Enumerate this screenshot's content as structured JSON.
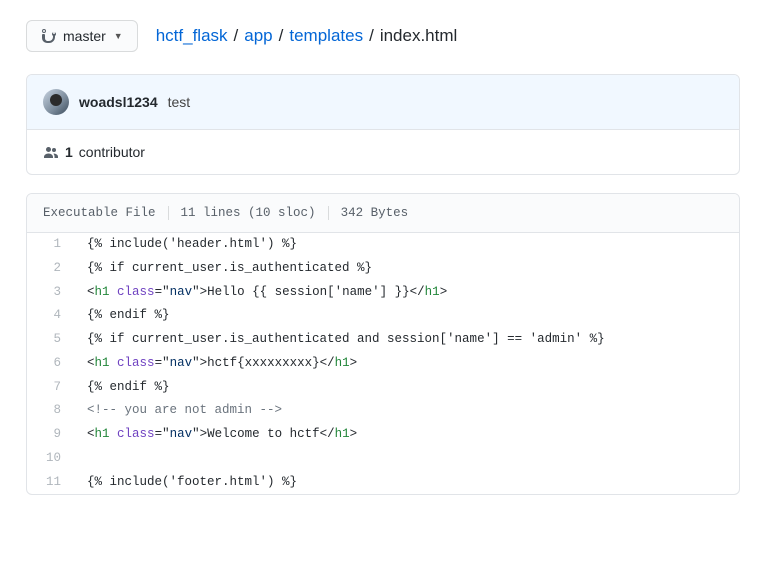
{
  "branch": {
    "label": "master"
  },
  "breadcrumb": {
    "root": "hctf_flask",
    "p1": "app",
    "p2": "templates",
    "current": "index.html"
  },
  "commit": {
    "author": "woadsl1234",
    "message": "test"
  },
  "contributors": {
    "count": "1",
    "label": "contributor"
  },
  "file_meta": {
    "executable": "Executable File",
    "lines": "11 lines (10 sloc)",
    "bytes": "342 Bytes"
  },
  "code": {
    "l1": "{% include('header.html') %}",
    "l2": "{% if current_user.is_authenticated %}",
    "l3_open": "<",
    "l3_tag": "h1",
    "l3_sp": " ",
    "l3_attr": "class",
    "l3_eq": "=\"",
    "l3_val": "nav",
    "l3_q2": "\">",
    "l3_text": "Hello {{ session['name'] }}",
    "l3_close": "</",
    "l3_tag2": "h1",
    "l3_gt": ">",
    "l4": "{% endif %}",
    "l5": "{% if current_user.is_authenticated and session['name'] == 'admin' %}",
    "l6_text": "hctf{xxxxxxxxx}",
    "l7": "{% endif %}",
    "l8_open": "<!--",
    "l8_body": " you are not admin ",
    "l8_close": "-->",
    "l9_text": "Welcome to hctf",
    "l11": "{% include('footer.html') %}",
    "nums": {
      "1": "1",
      "2": "2",
      "3": "3",
      "4": "4",
      "5": "5",
      "6": "6",
      "7": "7",
      "8": "8",
      "9": "9",
      "10": "10",
      "11": "11"
    }
  }
}
